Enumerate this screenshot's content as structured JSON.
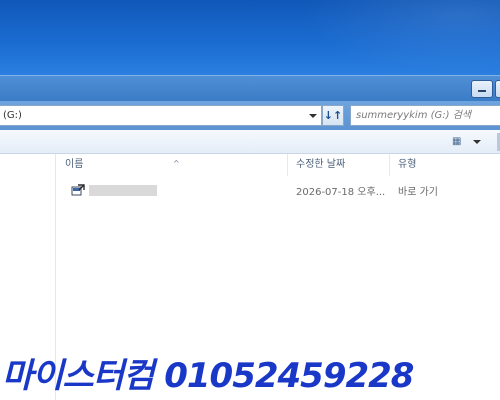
{
  "window": {
    "address_text": "(G:)",
    "refresh_glyph": "↓↑",
    "search_placeholder": "summeryykim (G:) 검색",
    "view_icon_glyph": "▦"
  },
  "filelist": {
    "columns": [
      {
        "label": "이름"
      },
      {
        "label": "수정한 날짜"
      },
      {
        "label": "유형"
      }
    ],
    "sort_glyph": "^",
    "rows": [
      {
        "name": "",
        "modified": "2026-07-18 오후...",
        "type": "바로 가기",
        "icon": "shortcut-icon"
      }
    ]
  },
  "watermark": {
    "text": "마이스터컴 01052459228"
  },
  "colors": {
    "desktop": "#1a6bd0",
    "titlebar": "#3b7cc7",
    "watermark": "#1a38c8"
  }
}
